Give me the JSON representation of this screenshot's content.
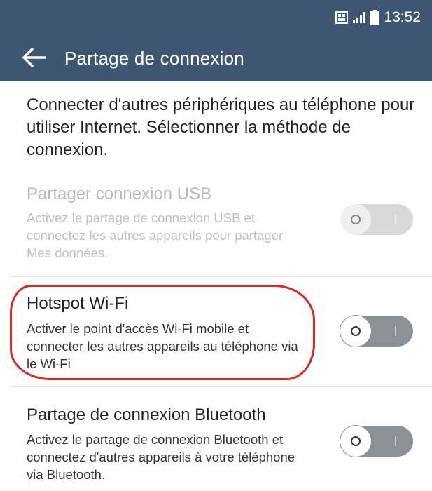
{
  "status_bar": {
    "time": "13:52",
    "icons": [
      "sim-icon",
      "signal-icon",
      "battery-icon"
    ]
  },
  "header": {
    "title": "Partage de connexion",
    "back_icon": "arrow-left-icon"
  },
  "intro": "Connecter d'autres périphériques au téléphone pour utiliser Internet. Sélectionner la méthode de connexion.",
  "options": [
    {
      "title": "Partager connexion USB",
      "description": "Activez le partage de connexion USB et connectez les autres appareils pour partager Mes données.",
      "enabled": false,
      "toggle_on": false
    },
    {
      "title": "Hotspot Wi-Fi",
      "description": "Activer le point d'accès Wi-Fi mobile et connecter les autres appareils au téléphone via le Wi-Fi",
      "enabled": true,
      "toggle_on": false
    },
    {
      "title": "Partage de connexion Bluetooth",
      "description": "Activez le partage de connexion Bluetooth et connectez d'autres appareils à votre téléphone via Bluetooth.",
      "enabled": true,
      "toggle_on": false
    }
  ],
  "colors": {
    "header_bg": "#3f5673",
    "annotation": "#e1261f",
    "text": "#222222",
    "disabled_text": "#b9b9b9"
  }
}
